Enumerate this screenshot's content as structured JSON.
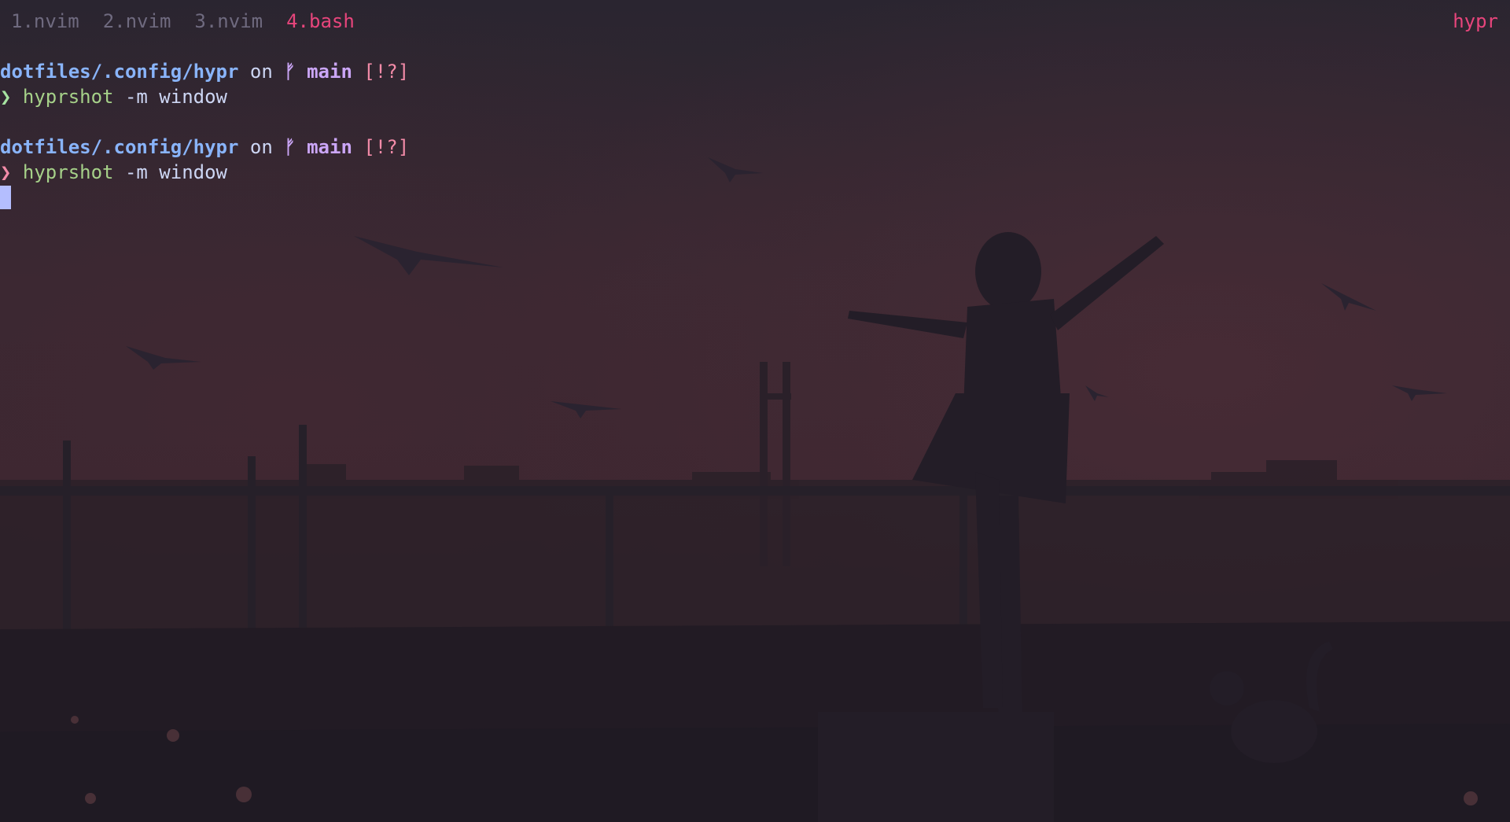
{
  "colors": {
    "active_tab": "#e8457c",
    "inactive_tab": "#6f6a7f",
    "path": "#89b4fa",
    "branch": "#cba6f7",
    "git_status": "#f38ba8",
    "prompt_success": "#a6e3a1",
    "prompt_error": "#f38ba8",
    "command": "#a6d189",
    "cursor": "#b4befe",
    "background": "#221d29"
  },
  "tabbar": {
    "tabs": [
      {
        "label": "1.nvim",
        "active": false
      },
      {
        "label": "2.nvim",
        "active": false
      },
      {
        "label": "3.nvim",
        "active": false
      },
      {
        "label": "4.bash",
        "active": true
      }
    ],
    "session": "hypr"
  },
  "terminal": {
    "blocks": [
      {
        "path": "dotfiles/.config/hypr",
        "on": "on",
        "branch_icon": "git-branch-icon",
        "branch_glyph": "ᚠ",
        "branch": "main",
        "status": "[!?]",
        "prompt_symbol": "❯",
        "prompt_state": "success",
        "command": "hyprshot",
        "args": "-m window"
      },
      {
        "path": "dotfiles/.config/hypr",
        "on": "on",
        "branch_icon": "git-branch-icon",
        "branch_glyph": "ᚠ",
        "branch": "main",
        "status": "[!?]",
        "prompt_symbol": "❯",
        "prompt_state": "error",
        "command": "hyprshot",
        "args": "-m window"
      }
    ]
  }
}
